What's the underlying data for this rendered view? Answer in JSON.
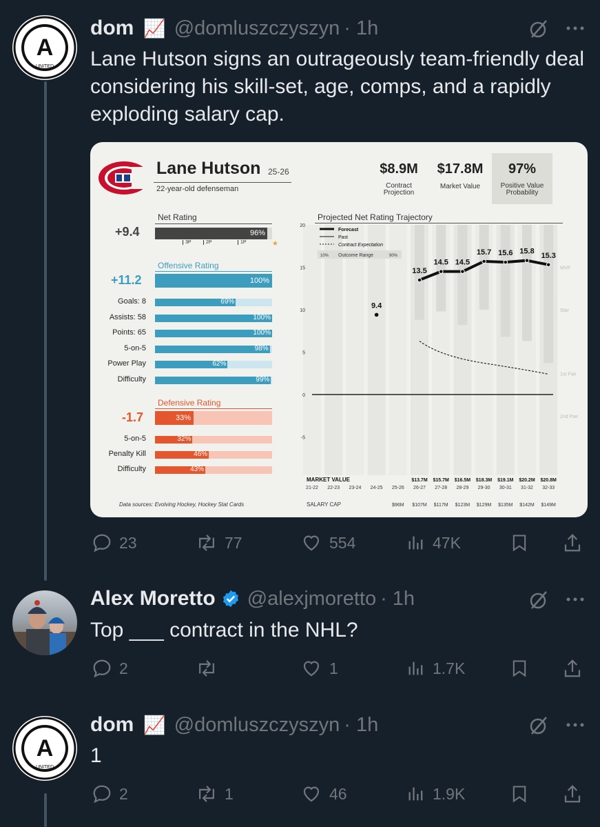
{
  "tweet1": {
    "name": "dom",
    "emoji": "📈",
    "handle": "@domluszczyszyn",
    "time": "· 1h",
    "text": "Lane Hutson signs an outrageously team-friendly deal considering his skill-set, age, comps, and a rapidly exploding salary cap.",
    "avatar_text": "A",
    "avatar_sub": "UNITED",
    "replies": "23",
    "retweets": "77",
    "likes": "554",
    "views": "47K"
  },
  "card": {
    "player": "Lane Hutson",
    "season": "25-26",
    "subtitle": "22-year-old defenseman",
    "stats": [
      {
        "value": "$8.9M",
        "label": "Contract Projection"
      },
      {
        "value": "$17.8M",
        "label": "Market Value"
      },
      {
        "value": "97%",
        "label": "Positive Value Probability"
      }
    ],
    "net_rating": {
      "title": "Net Rating",
      "value": "+9.4",
      "pct": "96%",
      "fill": 0.96,
      "ticks": [
        "3P",
        "2P",
        "1P"
      ]
    },
    "offensive": {
      "title": "Offensive Rating",
      "value": "+11.2",
      "pct": "100%",
      "fill": 1.0,
      "rows": [
        {
          "label": "Goals: 8",
          "pct": "69%",
          "fill": 0.69
        },
        {
          "label": "Assists: 58",
          "pct": "100%",
          "fill": 1.0
        },
        {
          "label": "Points: 65",
          "pct": "100%",
          "fill": 1.0
        },
        {
          "label": "5-on-5",
          "pct": "98%",
          "fill": 0.98
        },
        {
          "label": "Power Play",
          "pct": "62%",
          "fill": 0.62
        },
        {
          "label": "Difficulty",
          "pct": "99%",
          "fill": 0.99
        }
      ]
    },
    "defensive": {
      "title": "Defensive Rating",
      "value": "-1.7",
      "pct": "33%",
      "fill": 0.33,
      "rows": [
        {
          "label": "5-on-5",
          "pct": "32%",
          "fill": 0.32
        },
        {
          "label": "Penalty Kill",
          "pct": "46%",
          "fill": 0.46
        },
        {
          "label": "Difficulty",
          "pct": "43%",
          "fill": 0.43
        }
      ]
    },
    "source": "Data sources: Evolving Hockey, Hockey Stat Cards",
    "chart_data": {
      "type": "line",
      "title": "Projected Net Rating Trajectory",
      "legend": [
        "Forecast",
        "Past",
        "Contract Expectation"
      ],
      "range_label": [
        "10%",
        "Outcome Range",
        "90%"
      ],
      "x": [
        "21-22",
        "22-23",
        "23-24",
        "24-25",
        "25-26",
        "26-27",
        "27-28",
        "28-29",
        "29-30",
        "30-31",
        "31-32",
        "32-33"
      ],
      "ylim": [
        -8,
        20
      ],
      "yticks": [
        -5,
        0,
        5,
        10,
        15,
        20
      ],
      "series": [
        {
          "name": "Past",
          "x": [
            "24-25"
          ],
          "values": [
            9.4
          ]
        },
        {
          "name": "Forecast",
          "x": [
            "26-27",
            "27-28",
            "28-29",
            "29-30",
            "30-31",
            "31-32",
            "32-33"
          ],
          "values": [
            13.5,
            14.5,
            14.5,
            15.7,
            15.6,
            15.8,
            15.3
          ]
        },
        {
          "name": "Contract Expectation",
          "x": [
            "26-27",
            "32-33"
          ],
          "values": [
            6.3,
            2.4
          ]
        }
      ],
      "outcome_range": {
        "x": [
          "26-27",
          "27-28",
          "28-29",
          "29-30",
          "30-31",
          "31-32",
          "32-33"
        ],
        "low": [
          8.8,
          9.8,
          8.2,
          10.0,
          6.8,
          6.3,
          3.7
        ],
        "high": [
          20,
          20,
          20,
          20,
          20,
          20,
          20
        ]
      },
      "tier_labels": [
        {
          "label": "MVP",
          "y": 15
        },
        {
          "label": "Star",
          "y": 10
        },
        {
          "label": "1st Pair",
          "y": 2.5
        },
        {
          "label": "2nd Pair",
          "y": -2.5
        }
      ],
      "market_value_label": "MARKET VALUE",
      "market_values": [
        "$13.7M",
        "$15.7M",
        "$16.5M",
        "$18.3M",
        "$19.1M",
        "$20.2M",
        "$20.8M"
      ],
      "salary_cap_label": "SALARY CAP",
      "salary_caps": [
        "$96M",
        "$107M",
        "$117M",
        "$123M",
        "$129M",
        "$135M",
        "$142M",
        "$149M"
      ]
    }
  },
  "tweet2": {
    "name": "Alex Moretto",
    "handle": "@alexjmoretto",
    "time": "· 1h",
    "text": "Top ___ contract in the NHL?",
    "replies": "2",
    "retweets": "",
    "likes": "1",
    "views": "1.7K"
  },
  "tweet3": {
    "name": "dom",
    "emoji": "📈",
    "handle": "@domluszczyszyn",
    "time": "· 1h",
    "text": "1",
    "replies": "2",
    "retweets": "1",
    "likes": "46",
    "views": "1.9K"
  }
}
